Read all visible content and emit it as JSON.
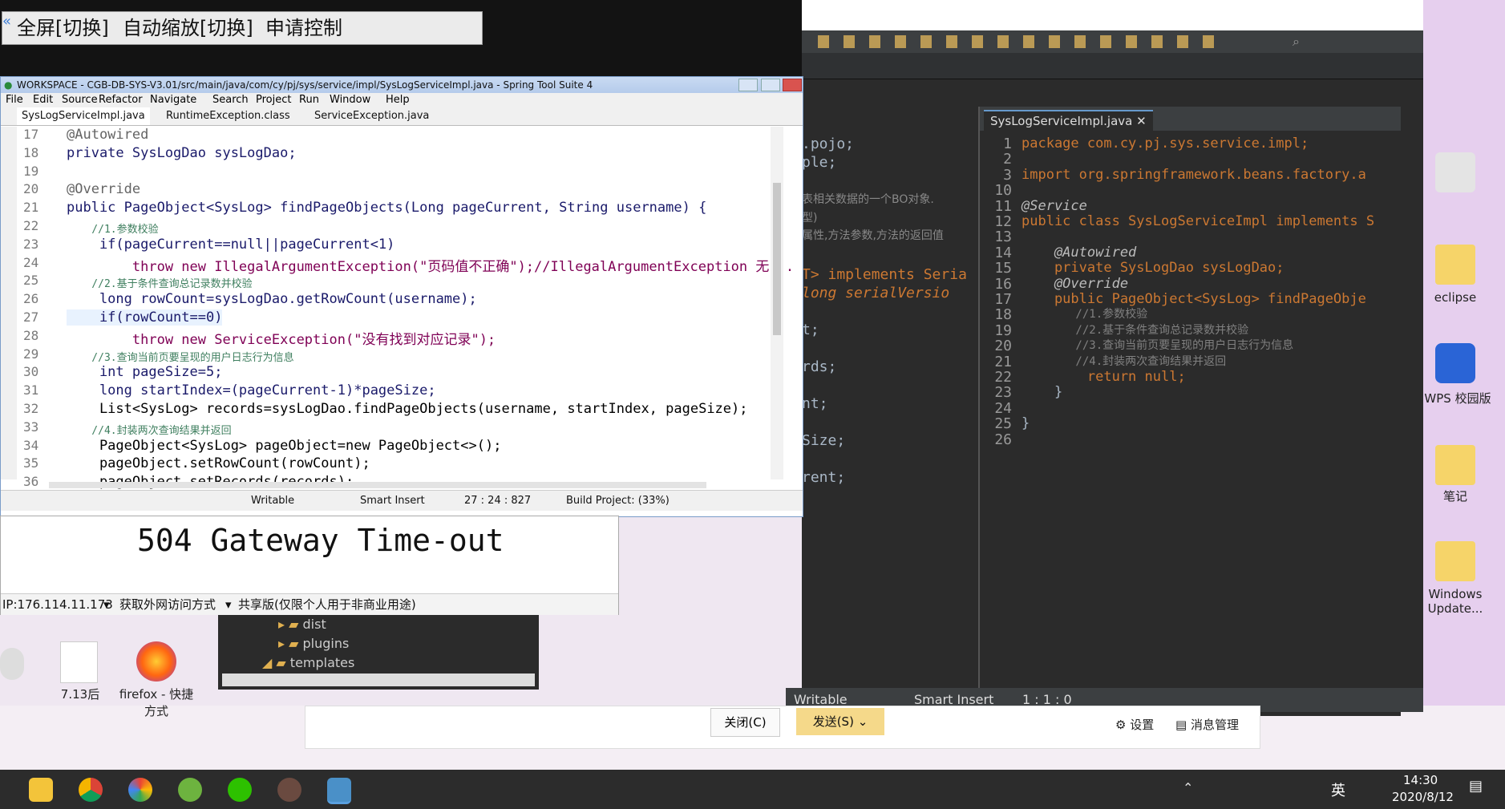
{
  "control_bar": {
    "fullscreen": "全屏[切换]",
    "autoscale": "自动缩放[切换]",
    "request_control": "申请控制"
  },
  "left_window": {
    "title": "WORKSPACE - CGB-DB-SYS-V3.01/src/main/java/com/cy/pj/sys/service/impl/SysLogServiceImpl.java - Spring Tool Suite 4",
    "menu": [
      "File",
      "Edit",
      "Source",
      "Refactor",
      "Navigate",
      "Search",
      "Project",
      "Run",
      "Window",
      "Help"
    ],
    "tabs": [
      "SysLogServiceImpl.java",
      "RuntimeException.class",
      "ServiceException.java"
    ],
    "line_numbers": [
      "17",
      "18",
      "19",
      "20",
      "21",
      "22",
      "23",
      "24",
      "25",
      "26",
      "27",
      "28",
      "29",
      "30",
      "31",
      "32",
      "33",
      "34",
      "35",
      "36"
    ],
    "code": [
      "@Autowired",
      "private SysLogDao sysLogDao;",
      "",
      "@Override",
      "public PageObject<SysLog> findPageObjects(Long pageCurrent, String username) {",
      "    //1.参数校验",
      "    if(pageCurrent==null||pageCurrent<1)",
      "        throw new IllegalArgumentException(\"页码值不正确\");//IllegalArgumentException 无...",
      "    //2.基于条件查询总记录数并校验",
      "    long rowCount=sysLogDao.getRowCount(username);",
      "    if(rowCount==0)",
      "        throw new ServiceException(\"没有找到对应记录\");",
      "    //3.查询当前页要呈现的用户日志行为信息",
      "    int pageSize=5;",
      "    long startIndex=(pageCurrent-1)*pageSize;",
      "    List<SysLog> records=sysLogDao.findPageObjects(username, startIndex, pageSize);",
      "    //4.封装两次查询结果并返回",
      "    PageObject<SysLog> pageObject=new PageObject<>();",
      "    pageObject.setRowCount(rowCount);",
      "    pageObject.setRecords(records);"
    ],
    "status": {
      "writable": "Writable",
      "insert": "Smart Insert",
      "position": "27 : 24 : 827",
      "build": "Build Project: (33%)"
    }
  },
  "gateway": {
    "title": "504 Gateway Time-out",
    "ip": "IP:176.114.11.173",
    "access": "获取外网访问方式",
    "edition": "共享版(仅限个人用于非商业用途)"
  },
  "tree": {
    "items": [
      "dist",
      "plugins",
      "templates"
    ]
  },
  "right_window": {
    "tab": "SysLogServiceImpl.java",
    "line_numbers": [
      "1",
      "2",
      "3",
      "10",
      "11",
      "12",
      "13",
      "14",
      "15",
      "16",
      "17",
      "18",
      "19",
      "20",
      "21",
      "22",
      "23",
      "24",
      "25",
      "26"
    ],
    "code": [
      "package com.cy.pj.sys.service.impl;",
      "",
      "import org.springframework.beans.factory.a",
      "",
      "@Service",
      "public class SysLogServiceImpl implements S",
      "",
      "    @Autowired",
      "    private SysLogDao sysLogDao;",
      "    @Override",
      "    public PageObject<SysLog> findPageObje",
      "        //1.参数校验",
      "        //2.基于条件查询总记录数并校验",
      "        //3.查询当前页要呈现的用户日志行为信息",
      "        //4.封装两次查询结果并返回",
      "        return null;",
      "    }",
      "",
      "}",
      ""
    ],
    "mid_fragments": [
      ".pojo;",
      "ple;",
      "表相关数据的一个BO对象.",
      "型)",
      "属性,方法参数,方法的返回值",
      "T> implements Seria",
      "long serialVersio",
      "t;",
      "rds;",
      "nt;",
      "Size;",
      "rent;"
    ],
    "status": {
      "writable": "Writable",
      "insert": "Smart Insert",
      "position": "1 : 1 : 0"
    }
  },
  "chat": {
    "close": "关闭(C)",
    "send": "发送(S)",
    "settings": "设置",
    "messages": "消息管理"
  },
  "desktop_icons": [
    "7.13后",
    "firefox - 快捷方式",
    "eclipse",
    "WPS 校园版",
    "笔记",
    "Windows Update..."
  ],
  "taskbar": {
    "time": "14:30",
    "date": "2020/8/12",
    "ime": "英"
  }
}
